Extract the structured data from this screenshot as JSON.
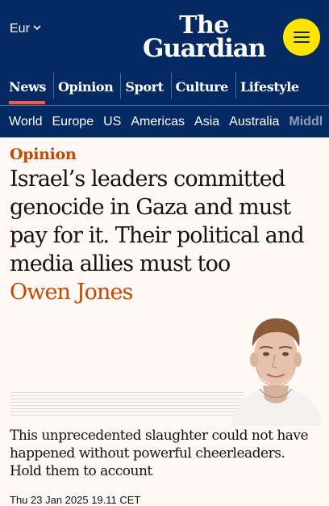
{
  "edition": {
    "label": "Eur"
  },
  "logo": {
    "line1": "The",
    "line2": "Guardian"
  },
  "pillars": [
    {
      "label": "News",
      "active": true
    },
    {
      "label": "Opinion"
    },
    {
      "label": "Sport"
    },
    {
      "label": "Culture"
    },
    {
      "label": "Lifestyle"
    }
  ],
  "subnav": [
    "World",
    "Europe",
    "US",
    "Americas",
    "Asia",
    "Australia",
    "Middl"
  ],
  "article": {
    "kicker": "Opinion",
    "headline": "Israel’s leaders committed genocide in Gaza and must pay for it. Their political and media allies must too",
    "byline": "Owen Jones",
    "standfirst": "This unprecedented slaughter could not have happened without powerful cheerleaders. Hold them to account",
    "dateline": "Thu 23 Jan 2025 19.11 CET"
  },
  "colors": {
    "brand": "#052962",
    "menu_button": "#ffe500",
    "opinion_accent": "#c74600",
    "news_accent": "#ff5943",
    "background": "#fef9f5"
  },
  "icons": {
    "edition_dropdown": "chevron-down-icon",
    "menu": "hamburger-menu-icon"
  }
}
